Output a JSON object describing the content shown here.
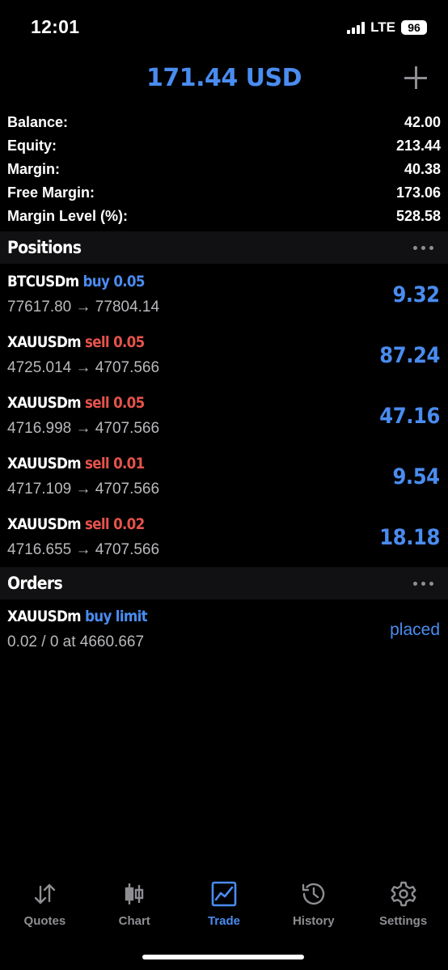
{
  "status_bar": {
    "time": "12:01",
    "network": "LTE",
    "battery": "96"
  },
  "header": {
    "title": "171.44 USD"
  },
  "summary": [
    {
      "label": "Balance:",
      "value": "42.00"
    },
    {
      "label": "Equity:",
      "value": "213.44"
    },
    {
      "label": "Margin:",
      "value": "40.38"
    },
    {
      "label": "Free Margin:",
      "value": "173.06"
    },
    {
      "label": "Margin Level (%):",
      "value": "528.58"
    }
  ],
  "positions": {
    "title": "Positions",
    "items": [
      {
        "symbol": "BTCUSDm",
        "side": "buy 0.05",
        "prices": "77617.80 → 77804.14",
        "profit": "9.32"
      },
      {
        "symbol": "XAUUSDm",
        "side": "sell 0.05",
        "prices": "4725.014 → 4707.566",
        "profit": "87.24"
      },
      {
        "symbol": "XAUUSDm",
        "side": "sell 0.05",
        "prices": "4716.998 → 4707.566",
        "profit": "47.16"
      },
      {
        "symbol": "XAUUSDm",
        "side": "sell 0.01",
        "prices": "4717.109 → 4707.566",
        "profit": "9.54"
      },
      {
        "symbol": "XAUUSDm",
        "side": "sell 0.02",
        "prices": "4716.655 → 4707.566",
        "profit": "18.18"
      }
    ]
  },
  "orders": {
    "title": "Orders",
    "items": [
      {
        "symbol": "XAUUSDm",
        "side": "buy limit",
        "details": "0.02 / 0 at 4660.667",
        "status": "placed"
      }
    ]
  },
  "tabs": [
    {
      "label": "Quotes",
      "icon": "quotes-arrows-icon"
    },
    {
      "label": "Chart",
      "icon": "candlestick-chart-icon"
    },
    {
      "label": "Trade",
      "icon": "trade-line-chart-icon",
      "active": true
    },
    {
      "label": "History",
      "icon": "history-clock-icon"
    },
    {
      "label": "Settings",
      "icon": "settings-gear-icon"
    }
  ],
  "colors": {
    "accent": "#4a8cf0",
    "sell": "#e5534b",
    "inactive": "#8e8e93",
    "background": "#000000",
    "section_header": "#111113"
  }
}
